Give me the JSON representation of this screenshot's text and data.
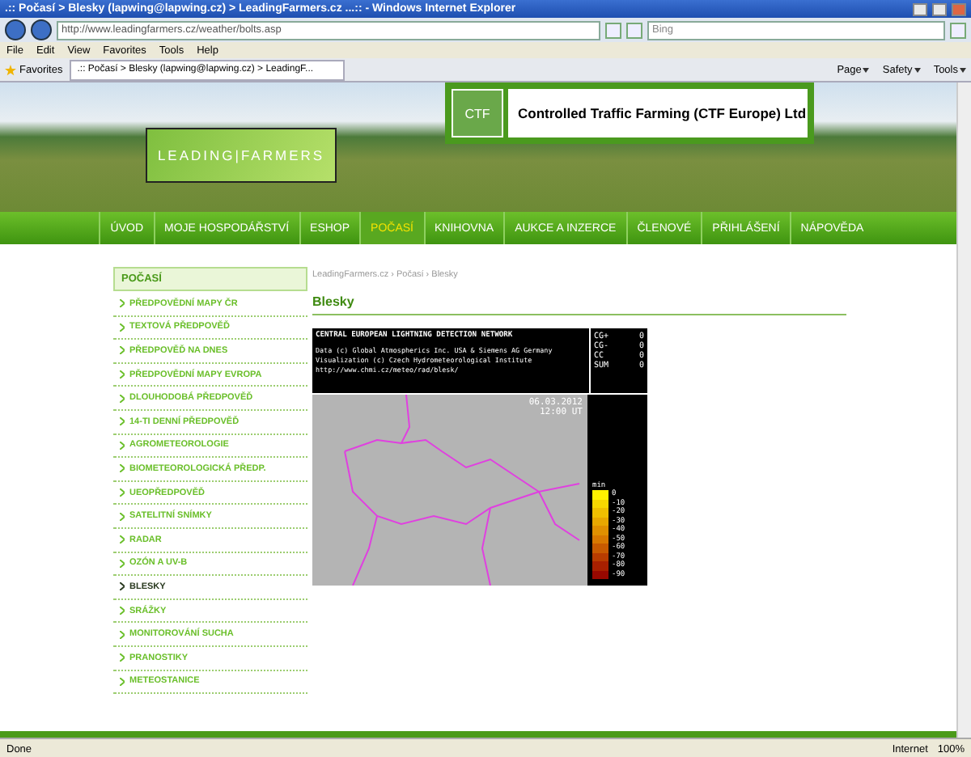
{
  "browser": {
    "title": ".:: Počasí > Blesky (lapwing@lapwing.cz) > LeadingFarmers.cz ...:: - Windows Internet Explorer",
    "address": "http://www.leadingfarmers.cz/weather/bolts.asp",
    "search_placeholder": "Bing",
    "menu": [
      "File",
      "Edit",
      "View",
      "Favorites",
      "Tools",
      "Help"
    ],
    "favorites": "Favorites",
    "tab_title": ".:: Počasí > Blesky (lapwing@lapwing.cz) > LeadingF...",
    "commands": [
      "Page",
      "Safety",
      "Tools"
    ]
  },
  "header": {
    "logo": "LEADING|FARMERS",
    "ctf_logo": "CTF",
    "banner": "Controlled Traffic Farming (CTF Europe) Ltd"
  },
  "nav": [
    {
      "label": "ÚVOD",
      "selected": false
    },
    {
      "label": "MOJE HOSPODÁŘSTVÍ",
      "selected": false
    },
    {
      "label": "ESHOP",
      "selected": false
    },
    {
      "label": "POČASÍ",
      "selected": true
    },
    {
      "label": "KNIHOVNA",
      "selected": false
    },
    {
      "label": "AUKCE A INZERCE",
      "selected": false
    },
    {
      "label": "ČLENOVÉ",
      "selected": false
    },
    {
      "label": "PŘIHLÁŠENÍ",
      "selected": false
    },
    {
      "label": "NÁPOVĚDA",
      "selected": false
    }
  ],
  "sidebar": {
    "title": "POČASÍ",
    "items": [
      {
        "label": "PŘEDPOVĚDNÍ MAPY ČR",
        "selected": false
      },
      {
        "label": "TEXTOVÁ PŘEDPOVĚĎ",
        "selected": false
      },
      {
        "label": "PŘEDPOVĚĎ NA DNES",
        "selected": false
      },
      {
        "label": "PŘEDPOVĚDNÍ MAPY EVROPA",
        "selected": false
      },
      {
        "label": "DLOUHODOBÁ PŘEDPOVĚĎ",
        "selected": false
      },
      {
        "label": "14-TI DENNÍ PŘEDPOVĚĎ",
        "selected": false
      },
      {
        "label": "AGROMETEOROLOGIE",
        "selected": false
      },
      {
        "label": "BIOMETEOROLOGICKÁ PŘEDP.",
        "selected": false
      },
      {
        "label": "UEOPŘEDPOVĚĎ",
        "selected": false
      },
      {
        "label": "SATELITNÍ SNÍMKY",
        "selected": false
      },
      {
        "label": "RADAR",
        "selected": false
      },
      {
        "label": "OZÓN A UV-B",
        "selected": false
      },
      {
        "label": "BLESKY",
        "selected": true
      },
      {
        "label": "SRÁŽKY",
        "selected": false
      },
      {
        "label": "MONITOROVÁNÍ SUCHA",
        "selected": false
      },
      {
        "label": "PRANOSTIKY",
        "selected": false
      },
      {
        "label": "METEOSTANICE",
        "selected": false
      }
    ]
  },
  "breadcrumb": "LeadingFarmers.cz › Počasí › Blesky",
  "heading": "Blesky",
  "lightning": {
    "title": "CENTRAL EUROPEAN LIGHTNING DETECTION NETWORK",
    "lines": [
      "Data (c) Global Atmospherics Inc. USA & Siemens AG Germany",
      "Visualization (c) Czech Hydrometeorological Institute",
      "http://www.chmi.cz/meteo/rad/blesk/"
    ],
    "stats": [
      {
        "label": "CG+",
        "value": "0"
      },
      {
        "label": "CG-",
        "value": "0"
      },
      {
        "label": "CC",
        "value": "0"
      },
      {
        "label": "SUM",
        "value": "0"
      }
    ],
    "date": "06.03.2012",
    "time": "12:00 UT",
    "legend_title": "min",
    "legend": [
      {
        "label": "0",
        "color": "#fff200"
      },
      {
        "label": "-10",
        "color": "#f8d800"
      },
      {
        "label": "-20",
        "color": "#f0c000"
      },
      {
        "label": "-30",
        "color": "#e8a800"
      },
      {
        "label": "-40",
        "color": "#e09000"
      },
      {
        "label": "-50",
        "color": "#d87800"
      },
      {
        "label": "-60",
        "color": "#c85a00"
      },
      {
        "label": "-70",
        "color": "#b83c00"
      },
      {
        "label": "-80",
        "color": "#a82000"
      },
      {
        "label": "-90",
        "color": "#980800"
      }
    ]
  },
  "status": {
    "text": "Done",
    "zone": "Internet",
    "zoom": "100%"
  }
}
